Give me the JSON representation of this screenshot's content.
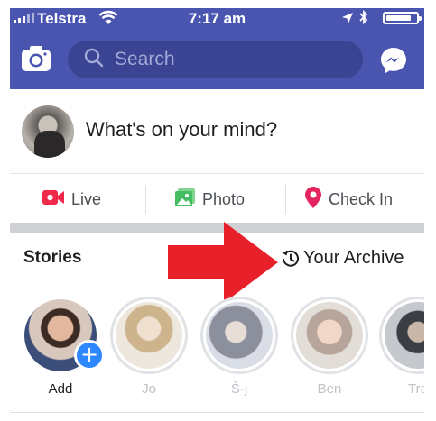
{
  "status_bar": {
    "carrier": "Telstra",
    "time": "7:17 am",
    "battery_level": 0.85
  },
  "navbar": {
    "search_placeholder": "Search",
    "colors": {
      "bar": "#4a55b0",
      "search": "#3a4493"
    },
    "icons": [
      "camera-icon",
      "search-icon",
      "messenger-icon"
    ]
  },
  "composer": {
    "prompt": "What's on your mind?"
  },
  "actions": [
    {
      "label": "Live",
      "icon": "live-video-icon",
      "color": "#f02849"
    },
    {
      "label": "Photo",
      "icon": "photo-icon",
      "color": "#45bd62"
    },
    {
      "label": "Check In",
      "icon": "location-pin-icon",
      "color": "#e4245e"
    }
  ],
  "stories": {
    "title": "Stories",
    "archive_label": "Your Archive",
    "archive_icon": "clock-history-icon",
    "annotation_arrow_color": "#e8202a",
    "items": [
      {
        "name": "Add"
      },
      {
        "name": "Jo"
      },
      {
        "name": "Š-j"
      },
      {
        "name": "Ben"
      },
      {
        "name": "Tro"
      }
    ]
  }
}
